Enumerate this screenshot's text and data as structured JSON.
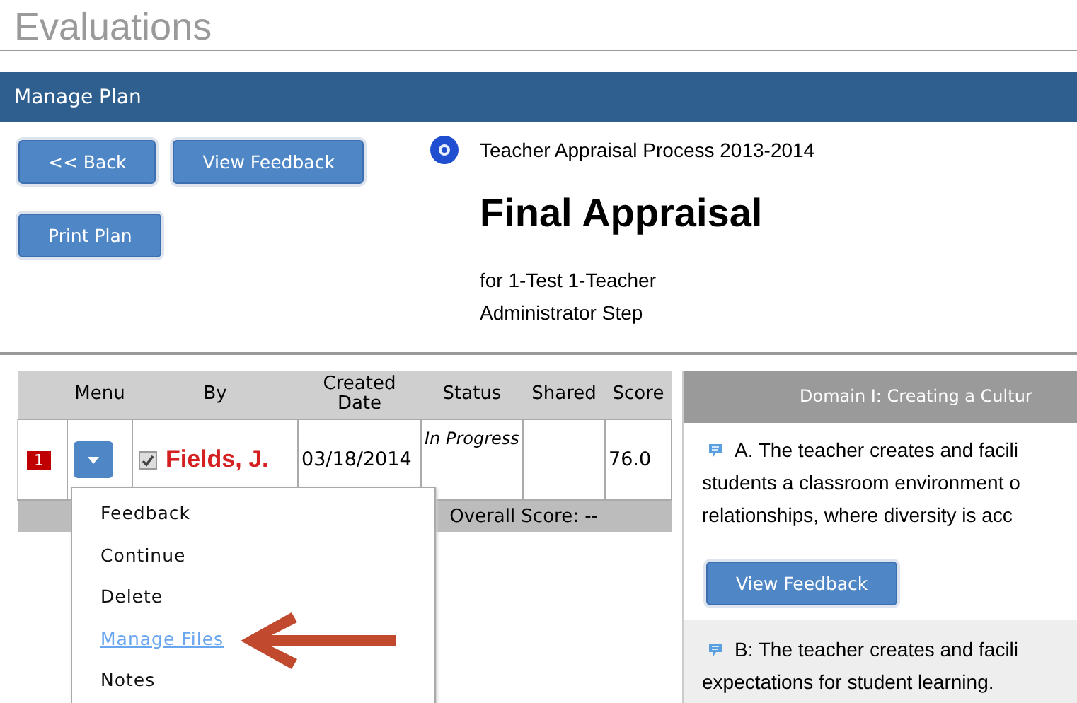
{
  "page_title": "Evaluations",
  "header_bar": {
    "title": "Manage Plan"
  },
  "buttons": [
    {
      "label": "<< Back"
    },
    {
      "label": "View Feedback"
    },
    {
      "label": "Print Plan"
    }
  ],
  "plan": {
    "process": "Teacher Appraisal Process 2013-2014",
    "title": "Final Appraisal",
    "for": "for 1-Test 1-Teacher",
    "step": "Administrator Step"
  },
  "table": {
    "columns": [
      "Menu",
      "By",
      "Created Date",
      "Status",
      "Shared",
      "Score"
    ],
    "rows": [
      {
        "number": "1",
        "checked": true,
        "by": "Fields, J.",
        "created_date": "03/18/2014",
        "status": "In Progress",
        "shared": "",
        "score": "76.0"
      }
    ],
    "footer": "Overall Score: --"
  },
  "row_menu": {
    "items": [
      {
        "label": "Feedback",
        "selected": false
      },
      {
        "label": "Continue",
        "selected": false
      },
      {
        "label": "Delete",
        "selected": false
      },
      {
        "label": "Manage Files",
        "selected": true
      },
      {
        "label": "Notes",
        "selected": false
      }
    ]
  },
  "domain_panel": {
    "title": "Domain I: Creating a Cultur",
    "items": [
      {
        "lines": [
          "A. The teacher creates and facili",
          "students a classroom environment o",
          "relationships, where diversity is acc"
        ],
        "button": "View Feedback",
        "shaded": false
      },
      {
        "lines": [
          "B: The teacher creates and facili",
          "expectations for student learning."
        ],
        "shaded": true
      }
    ]
  }
}
